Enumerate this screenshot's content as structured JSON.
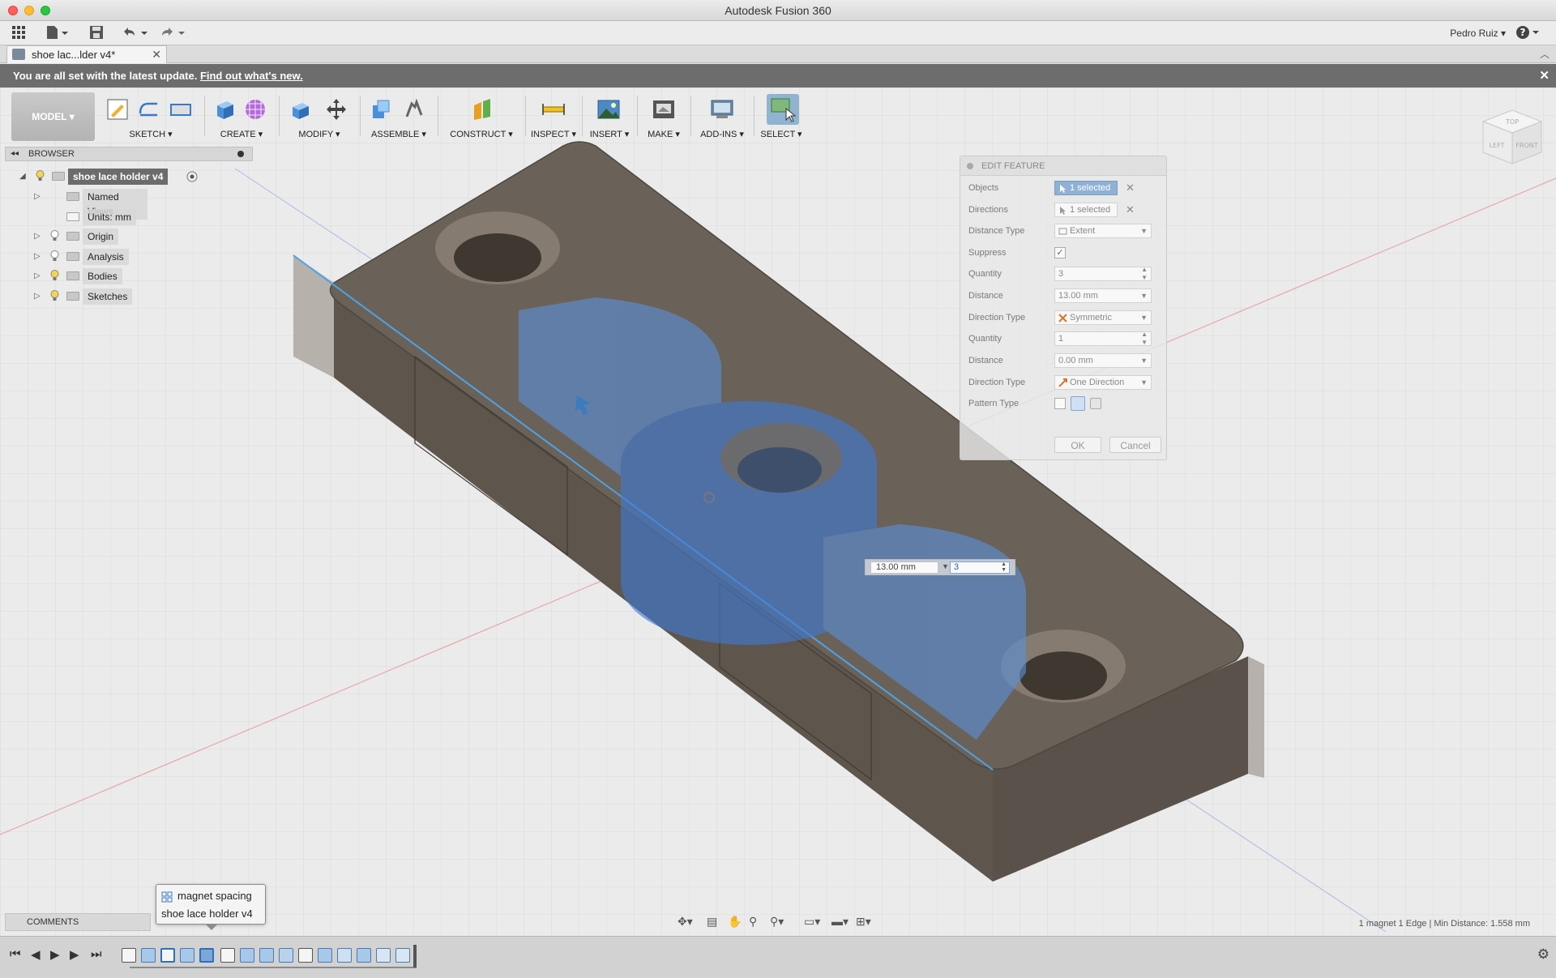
{
  "window": {
    "title": "Autodesk Fusion 360"
  },
  "app_toolbar": {
    "user": "Pedro Ruiz ▾",
    "help": "?"
  },
  "tab": {
    "label": "shoe lac...lder v4*"
  },
  "update_bar": {
    "message": "You are all set with the latest update.",
    "link": "Find out what's new."
  },
  "ribbon": {
    "workspace": "MODEL ▾",
    "groups": [
      {
        "label": "SKETCH ▾"
      },
      {
        "label": "CREATE ▾"
      },
      {
        "label": "MODIFY ▾"
      },
      {
        "label": "ASSEMBLE ▾"
      },
      {
        "label": "CONSTRUCT ▾"
      },
      {
        "label": "INSPECT ▾"
      },
      {
        "label": "INSERT ▾"
      },
      {
        "label": "MAKE ▾"
      },
      {
        "label": "ADD-INS ▾"
      },
      {
        "label": "SELECT ▾"
      }
    ]
  },
  "browser": {
    "title": "BROWSER",
    "root": "shoe lace holder v4",
    "items": [
      {
        "label": "Named Views"
      },
      {
        "label": "Units: mm"
      },
      {
        "label": "Origin"
      },
      {
        "label": "Analysis"
      },
      {
        "label": "Bodies"
      },
      {
        "label": "Sketches"
      }
    ]
  },
  "dialog": {
    "title": "EDIT FEATURE",
    "rows": [
      {
        "label": "Objects",
        "value": "1 selected"
      },
      {
        "label": "Directions",
        "value": "1 selected"
      },
      {
        "label": "Distance Type",
        "value": "Extent"
      },
      {
        "label": "Suppress",
        "value": "✓"
      },
      {
        "label": "Quantity",
        "value": "3"
      },
      {
        "label": "Distance",
        "value": "13.00 mm"
      },
      {
        "label": "Direction Type",
        "value": "Symmetric"
      },
      {
        "label": "Quantity",
        "value": "1"
      },
      {
        "label": "Distance",
        "value": "0.00 mm"
      },
      {
        "label": "Direction Type",
        "value": "One Direction"
      },
      {
        "label": "Pattern Type",
        "value": ""
      }
    ],
    "ok": "OK",
    "cancel": "Cancel"
  },
  "canvas_input": {
    "distance": "13.00 mm",
    "quantity": "3"
  },
  "comments": {
    "label": "COMMENTS"
  },
  "tooltip": {
    "feature": "magnet spacing",
    "component": "shoe lace holder v4"
  },
  "status_text": "1 magnet 1 Edge | Min Distance: 1.558 mm",
  "colors": {
    "accent_blue": "#4d86d6",
    "body_fill": "#6a6258",
    "update_bar": "#6d6d6d",
    "selected_field": "#8fb1d4"
  }
}
